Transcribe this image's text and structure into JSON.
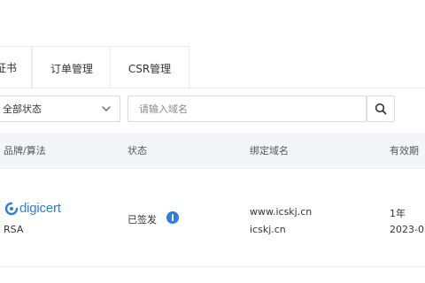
{
  "tabs": [
    {
      "label": "证书"
    },
    {
      "label": "订单管理"
    },
    {
      "label": "CSR管理"
    }
  ],
  "filter": {
    "status_select_value": "全部状态",
    "search_placeholder": "请输入域名"
  },
  "table": {
    "columns": [
      "品牌/算法",
      "状态",
      "绑定域名",
      "有效期"
    ],
    "rows": [
      {
        "brand": "digicert",
        "algorithm": "RSA",
        "status": "已签发",
        "domains": [
          "www.icskj.cn",
          "icskj.cn"
        ],
        "validity": "1年",
        "date": "2023-0"
      }
    ]
  },
  "colors": {
    "accent": "#2f7fd8",
    "header_bg": "#f3f5f8",
    "border": "#e8ebf0"
  },
  "icons": {
    "select_arrow": "chevron-down-icon",
    "search": "search-icon",
    "status": "info-icon",
    "brand_logo": "digicert-logo-icon"
  }
}
